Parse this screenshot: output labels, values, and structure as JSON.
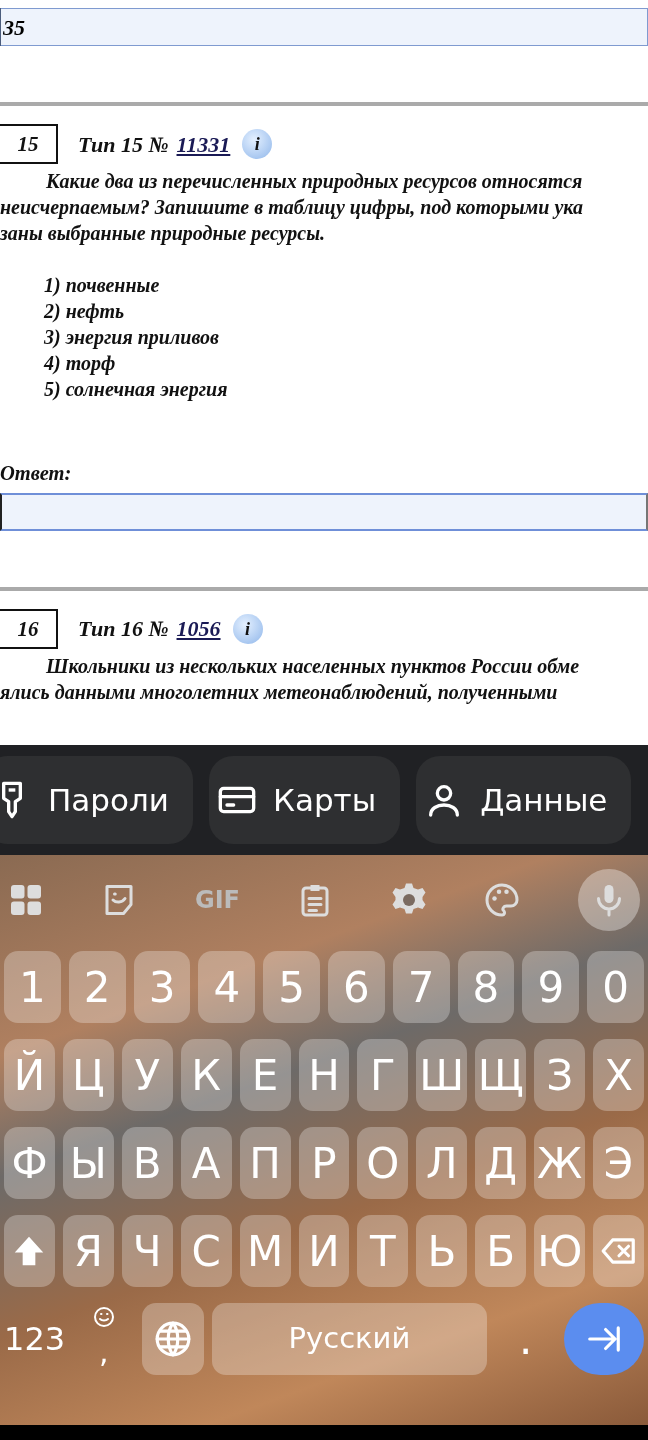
{
  "top_answer": {
    "value": "35"
  },
  "questions": [
    {
      "number": "15",
      "type_label": "Тип 15 №",
      "link": "11331",
      "info_label": "i",
      "lines": [
        "Какие два из перечисленных природных ресурсов относятся",
        "неисчерпаемым? Запишите в таблицу цифры, под которыми ука",
        "заны выбранные природные ресурсы."
      ],
      "options": [
        "1) почвенные",
        "2) нефть",
        "3) энергия приливов",
        "4) торф",
        "5) солнечная энергия"
      ],
      "answer_label": "Ответ:"
    },
    {
      "number": "16",
      "type_label": "Тип 16 №",
      "link": "1056",
      "info_label": "i",
      "lines": [
        "Школьники из нескольких населенных пунктов России обме",
        "ялись данными многолетних метеонаблюдений, полученными"
      ]
    }
  ],
  "keyboard": {
    "suggestions": [
      {
        "kind": "key",
        "label": "Пароли"
      },
      {
        "kind": "card",
        "label": "Карты"
      },
      {
        "kind": "person",
        "label": "Данные"
      }
    ],
    "toolbar": [
      {
        "kind": "grid"
      },
      {
        "kind": "sticker"
      },
      {
        "kind": "gif",
        "label": "GIF"
      },
      {
        "kind": "clipboard"
      },
      {
        "kind": "gear"
      },
      {
        "kind": "palette"
      },
      {
        "kind": "mic"
      }
    ],
    "number_row": [
      {
        "kind": "char",
        "label": "1"
      },
      {
        "kind": "char",
        "label": "2"
      },
      {
        "kind": "char",
        "label": "3"
      },
      {
        "kind": "char",
        "label": "4"
      },
      {
        "kind": "char",
        "label": "5"
      },
      {
        "kind": "char",
        "label": "6"
      },
      {
        "kind": "char",
        "label": "7"
      },
      {
        "kind": "char",
        "label": "8"
      },
      {
        "kind": "char",
        "label": "9"
      },
      {
        "kind": "char",
        "label": "0"
      }
    ],
    "letter_rows": [
      [
        {
          "kind": "char",
          "label": "Й"
        },
        {
          "kind": "char",
          "label": "Ц"
        },
        {
          "kind": "char",
          "label": "У"
        },
        {
          "kind": "char",
          "label": "К"
        },
        {
          "kind": "char",
          "label": "Е"
        },
        {
          "kind": "char",
          "label": "Н"
        },
        {
          "kind": "char",
          "label": "Г"
        },
        {
          "kind": "char",
          "label": "Ш"
        },
        {
          "kind": "char",
          "label": "Щ"
        },
        {
          "kind": "char",
          "label": "З"
        },
        {
          "kind": "char",
          "label": "Х"
        }
      ],
      [
        {
          "kind": "char",
          "label": "Ф"
        },
        {
          "kind": "char",
          "label": "Ы"
        },
        {
          "kind": "char",
          "label": "В"
        },
        {
          "kind": "char",
          "label": "А"
        },
        {
          "kind": "char",
          "label": "П"
        },
        {
          "kind": "char",
          "label": "Р"
        },
        {
          "kind": "char",
          "label": "О"
        },
        {
          "kind": "char",
          "label": "Л"
        },
        {
          "kind": "char",
          "label": "Д"
        },
        {
          "kind": "char",
          "label": "Ж"
        },
        {
          "kind": "char",
          "label": "Э"
        }
      ],
      [
        {
          "kind": "shift"
        },
        {
          "kind": "char",
          "label": "Я"
        },
        {
          "kind": "char",
          "label": "Ч"
        },
        {
          "kind": "char",
          "label": "С"
        },
        {
          "kind": "char",
          "label": "М"
        },
        {
          "kind": "char",
          "label": "И"
        },
        {
          "kind": "char",
          "label": "Т"
        },
        {
          "kind": "char",
          "label": "Ь"
        },
        {
          "kind": "char",
          "label": "Б"
        },
        {
          "kind": "char",
          "label": "Ю"
        },
        {
          "kind": "backspace"
        }
      ]
    ],
    "bottom_row": [
      {
        "kind": "mode",
        "label": "123"
      },
      {
        "kind": "emoji",
        "label": ","
      },
      {
        "kind": "globe"
      },
      {
        "kind": "space",
        "label": "Русский"
      },
      {
        "kind": "flat",
        "label": "."
      },
      {
        "kind": "enter"
      }
    ]
  }
}
